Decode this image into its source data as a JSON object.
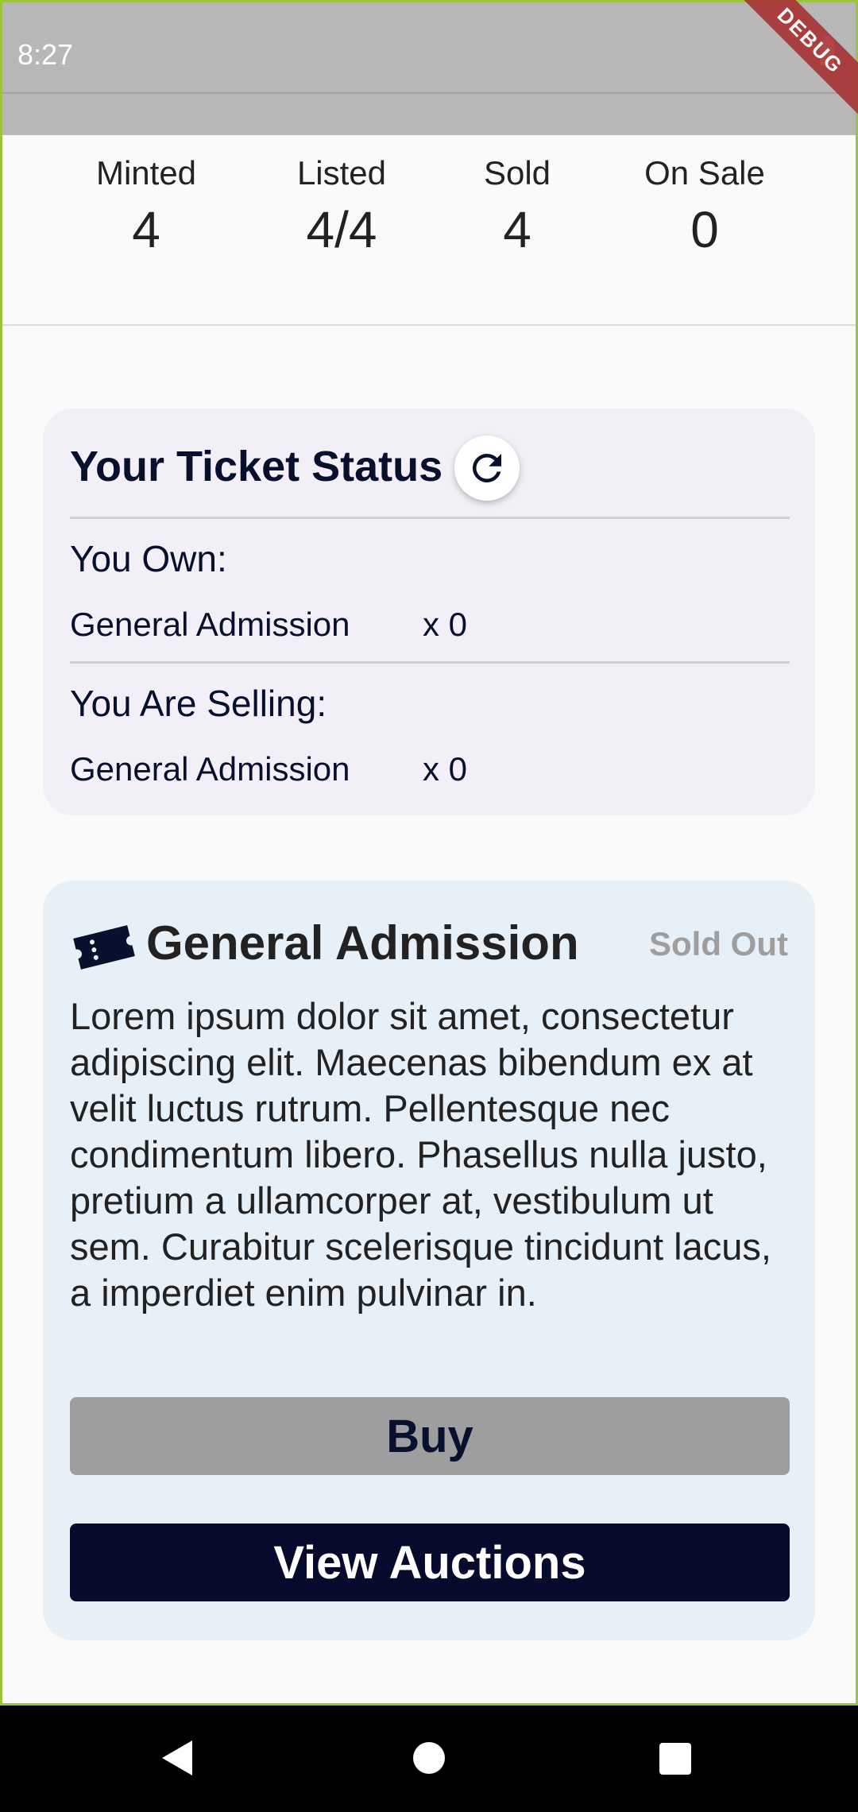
{
  "status_bar": {
    "time": "8:27"
  },
  "debug_banner": "DEBUG",
  "stats": [
    {
      "label": "Minted",
      "value": "4"
    },
    {
      "label": "Listed",
      "value": "4/4"
    },
    {
      "label": "Sold",
      "value": "4"
    },
    {
      "label": "On Sale",
      "value": "0"
    }
  ],
  "ticket_status": {
    "title": "Your Ticket Status",
    "own_heading": "You Own:",
    "own_item": "General Admission",
    "own_count": "x 0",
    "selling_heading": "You Are Selling:",
    "selling_item": "General Admission",
    "selling_count": "x 0"
  },
  "ticket": {
    "title": "General Admission",
    "availability": "Sold Out",
    "description": "Lorem ipsum dolor sit amet, consectetur adipiscing elit. Maecenas bibendum ex at velit luctus rutrum. Pellentesque nec condimentum libero. Phasellus nulla justo, pretium a ullamcorper at, vestibulum ut sem. Curabitur scelerisque tincidunt lacus, a imperdiet enim pulvinar in.",
    "buy_label": "Buy",
    "auctions_label": "View Auctions"
  },
  "icons": {
    "refresh": "refresh-icon",
    "ticket": "ticket-icon"
  },
  "colors": {
    "primary": "#060b2d",
    "status_card_bg": "#f2f0f6",
    "ticket_card_bg": "#e7f0f6",
    "disabled": "#9e9e9e"
  }
}
